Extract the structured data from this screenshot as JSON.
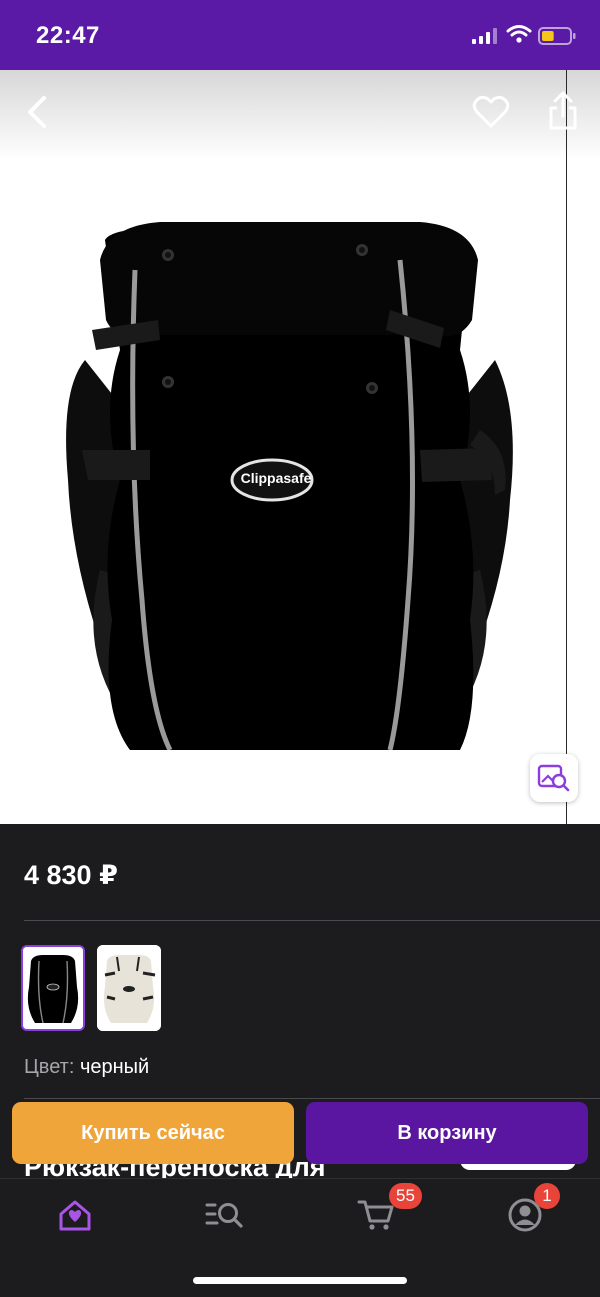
{
  "status_bar": {
    "time": "22:47",
    "battery_level": 0.45,
    "battery_color": "#f5c518"
  },
  "gallery": {
    "brand_logo_text": "Clippasafe",
    "product_image": "black baby carrier"
  },
  "product": {
    "price": "4 830 ₽",
    "color_label": "Цвет:",
    "color_value": "черный",
    "title_partial": "Рюкзак-переноска для"
  },
  "swatches": [
    {
      "name": "black",
      "selected": true
    },
    {
      "name": "beige",
      "selected": false
    }
  ],
  "actions": {
    "buy_now": "Купить сейчас",
    "add_to_cart": "В корзину"
  },
  "tabs": [
    {
      "name": "home",
      "icon": "home-icon",
      "active": true
    },
    {
      "name": "catalog",
      "icon": "catalog-search-icon",
      "active": false
    },
    {
      "name": "cart",
      "icon": "cart-icon",
      "active": false,
      "badge": "55"
    },
    {
      "name": "profile",
      "icon": "profile-icon",
      "active": false,
      "badge": "1"
    }
  ],
  "colors": {
    "accent": "#5a1aa5",
    "buy_button": "#f0a53a",
    "cart_button": "#5a16a0",
    "badge": "#e8443a",
    "active_tab": "#a855e6"
  }
}
